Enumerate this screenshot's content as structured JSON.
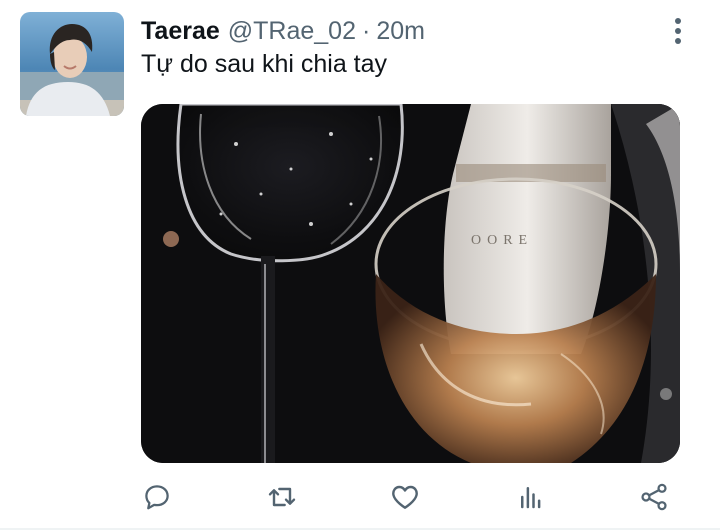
{
  "tweet": {
    "display_name": "Taerae",
    "handle": "@TRae_02",
    "separator": "·",
    "time": "20m",
    "text": "Tự do sau khi chia tay"
  },
  "icons": {
    "more": "more-vertical-icon",
    "reply": "reply-icon",
    "retweet": "retweet-icon",
    "like": "heart-icon",
    "analytics": "analytics-icon",
    "share": "share-icon"
  },
  "colors": {
    "text": "#0f1419",
    "secondary": "#536471",
    "icon": "#536471"
  }
}
